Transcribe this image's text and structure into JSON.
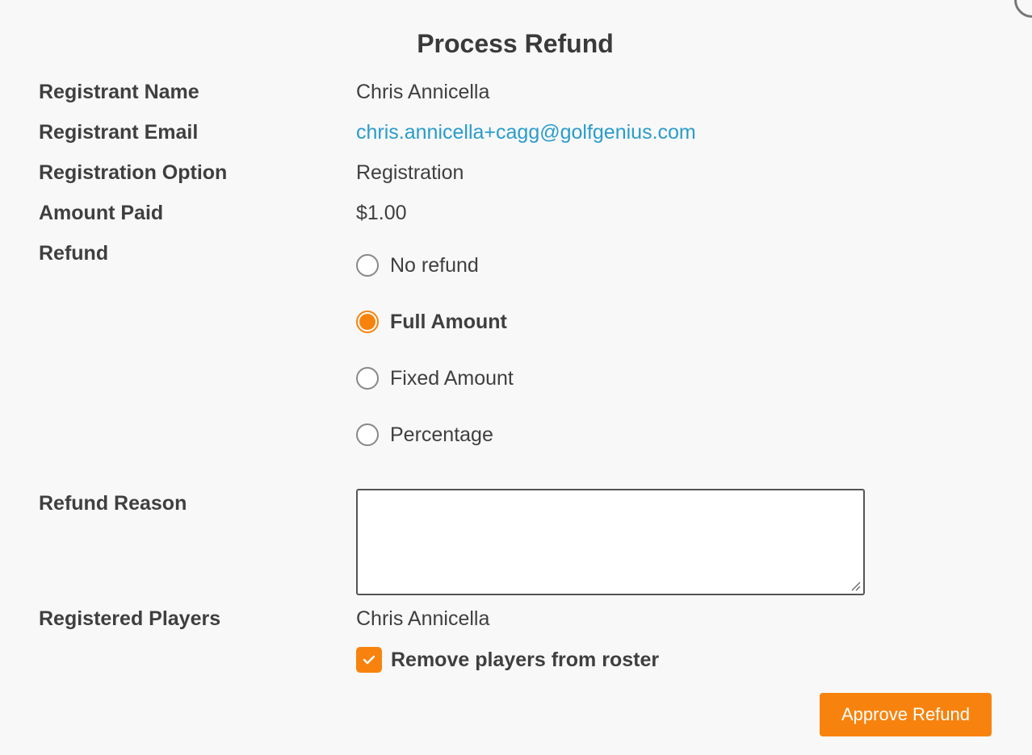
{
  "dialog": {
    "title": "Process Refund"
  },
  "fields": {
    "registrant_name": {
      "label": "Registrant Name",
      "value": "Chris Annicella"
    },
    "registrant_email": {
      "label": "Registrant Email",
      "value": "chris.annicella+cagg@golfgenius.com"
    },
    "registration_option": {
      "label": "Registration Option",
      "value": "Registration"
    },
    "amount_paid": {
      "label": "Amount Paid",
      "value": "$1.00"
    },
    "refund": {
      "label": "Refund",
      "options": [
        {
          "label": "No refund",
          "selected": false
        },
        {
          "label": "Full Amount",
          "selected": true
        },
        {
          "label": "Fixed Amount",
          "selected": false
        },
        {
          "label": "Percentage",
          "selected": false
        }
      ]
    },
    "refund_reason": {
      "label": "Refund Reason",
      "value": "",
      "placeholder": ""
    },
    "registered_players": {
      "label": "Registered Players",
      "players": [
        "Chris Annicella"
      ],
      "remove_from_roster": {
        "label": "Remove players from roster",
        "checked": true
      }
    }
  },
  "actions": {
    "approve_label": "Approve Refund"
  },
  "colors": {
    "accent": "#f7830e",
    "link": "#2a9ccb",
    "text": "#3f3f3f",
    "background": "#f8f8f8"
  }
}
